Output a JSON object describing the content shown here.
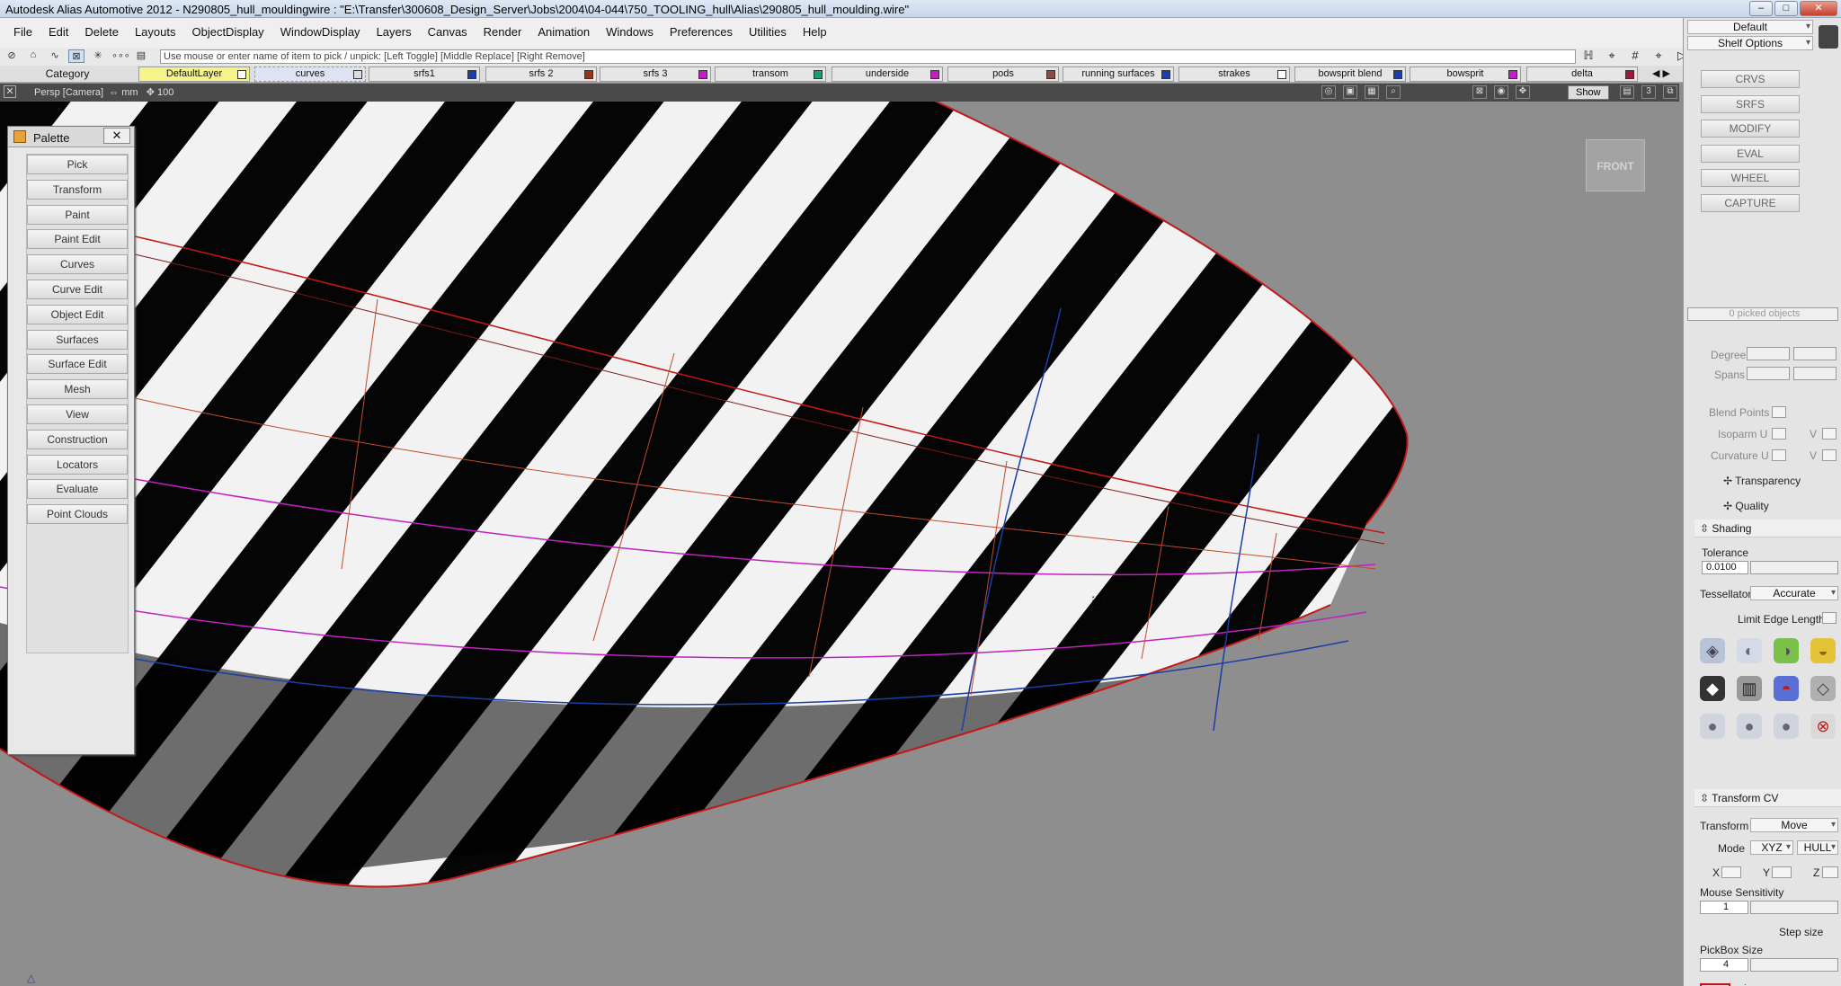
{
  "window": {
    "title": "Autodesk Alias Automotive 2012 - N290805_hull_mouldingwire : \"E:\\Transfer\\300608_Design_Server\\Jobs\\2004\\04-044\\750_TOOLING_hull\\Alias\\290805_hull_moulding.wire\"",
    "minimize": "‒",
    "maximize": "□",
    "close": "✕"
  },
  "menu": [
    "File",
    "Edit",
    "Delete",
    "Layouts",
    "ObjectDisplay",
    "WindowDisplay",
    "Layers",
    "Canvas",
    "Render",
    "Animation",
    "Windows",
    "Preferences",
    "Utilities",
    "Help"
  ],
  "prompt": {
    "text": "Use mouse or enter name of item to pick / unpick: [Left Toggle] [Middle Replace] [Right Remove]"
  },
  "layers": {
    "category_label": "Category",
    "items": [
      {
        "name": "DefaultLayer",
        "color": "#ffffff",
        "highlight": "#f4f48a"
      },
      {
        "name": "curves",
        "color": "#dddddd",
        "highlight": "#dde3f0"
      },
      {
        "name": "srfs1",
        "color": "#1a3fa6"
      },
      {
        "name": "srfs 2",
        "color": "#9a3318"
      },
      {
        "name": "srfs 3",
        "color": "#c21fc2"
      },
      {
        "name": "transom",
        "color": "#18a06a"
      },
      {
        "name": "underside",
        "color": "#c21fc2"
      },
      {
        "name": "pods",
        "color": "#8b4a42"
      },
      {
        "name": "running surfaces",
        "color": "#1a3fa6"
      },
      {
        "name": "strakes",
        "color": "#ffffff"
      },
      {
        "name": "bowsprit blend",
        "color": "#1a3fa6"
      },
      {
        "name": "bowsprit",
        "color": "#c21fc2"
      },
      {
        "name": "delta",
        "color": "#a0183a"
      }
    ]
  },
  "view": {
    "name": "Persp [Camera]",
    "units": "mm",
    "grid_value": "100",
    "show_label": "Show",
    "viewcube_label": "FRONT"
  },
  "palette": {
    "title": "Palette",
    "close": "✕",
    "items": [
      "Pick",
      "Transform",
      "Paint",
      "Paint Edit",
      "Curves",
      "Curve Edit",
      "Object Edit",
      "Surfaces",
      "Surface Edit",
      "Mesh",
      "View",
      "Construction",
      "Locators",
      "Evaluate",
      "Point Clouds"
    ]
  },
  "shelf": {
    "preset": "Default",
    "options_label": "Shelf Options",
    "buttons": [
      "CRVS",
      "SRFS",
      "MODIFY",
      "EVAL",
      "WHEEL",
      "CAPTURE"
    ]
  },
  "control_panel": {
    "picked_objects": "0 picked objects",
    "degree_label": "Degree",
    "spans_label": "Spans",
    "blend_points_label": "Blend Points",
    "isoparm_label": "Isoparm U",
    "curvature_label": "Curvature U",
    "v_label": "V",
    "transparency_label": "Transparency",
    "quality_label": "Quality",
    "shading_label": "Shading",
    "tolerance_label": "Tolerance",
    "tolerance_value": "0.0100",
    "tessellator_label": "Tessellator",
    "tessellator_value": "Accurate",
    "limit_edge_label": "Limit Edge Length",
    "transform_cv_label": "Transform CV",
    "transform_label": "Transform",
    "transform_value": "Move",
    "mode_label": "Mode",
    "mode_value": "XYZ",
    "mode_value2": "HULL",
    "x_label": "X",
    "y_label": "Y",
    "z_label": "Z",
    "mouse_sensitivity_label": "Mouse Sensitivity",
    "mouse_sensitivity_value": "1",
    "step_size_label": "Step size",
    "pickbox_label": "PickBox Size",
    "pickbox_value": "4"
  }
}
